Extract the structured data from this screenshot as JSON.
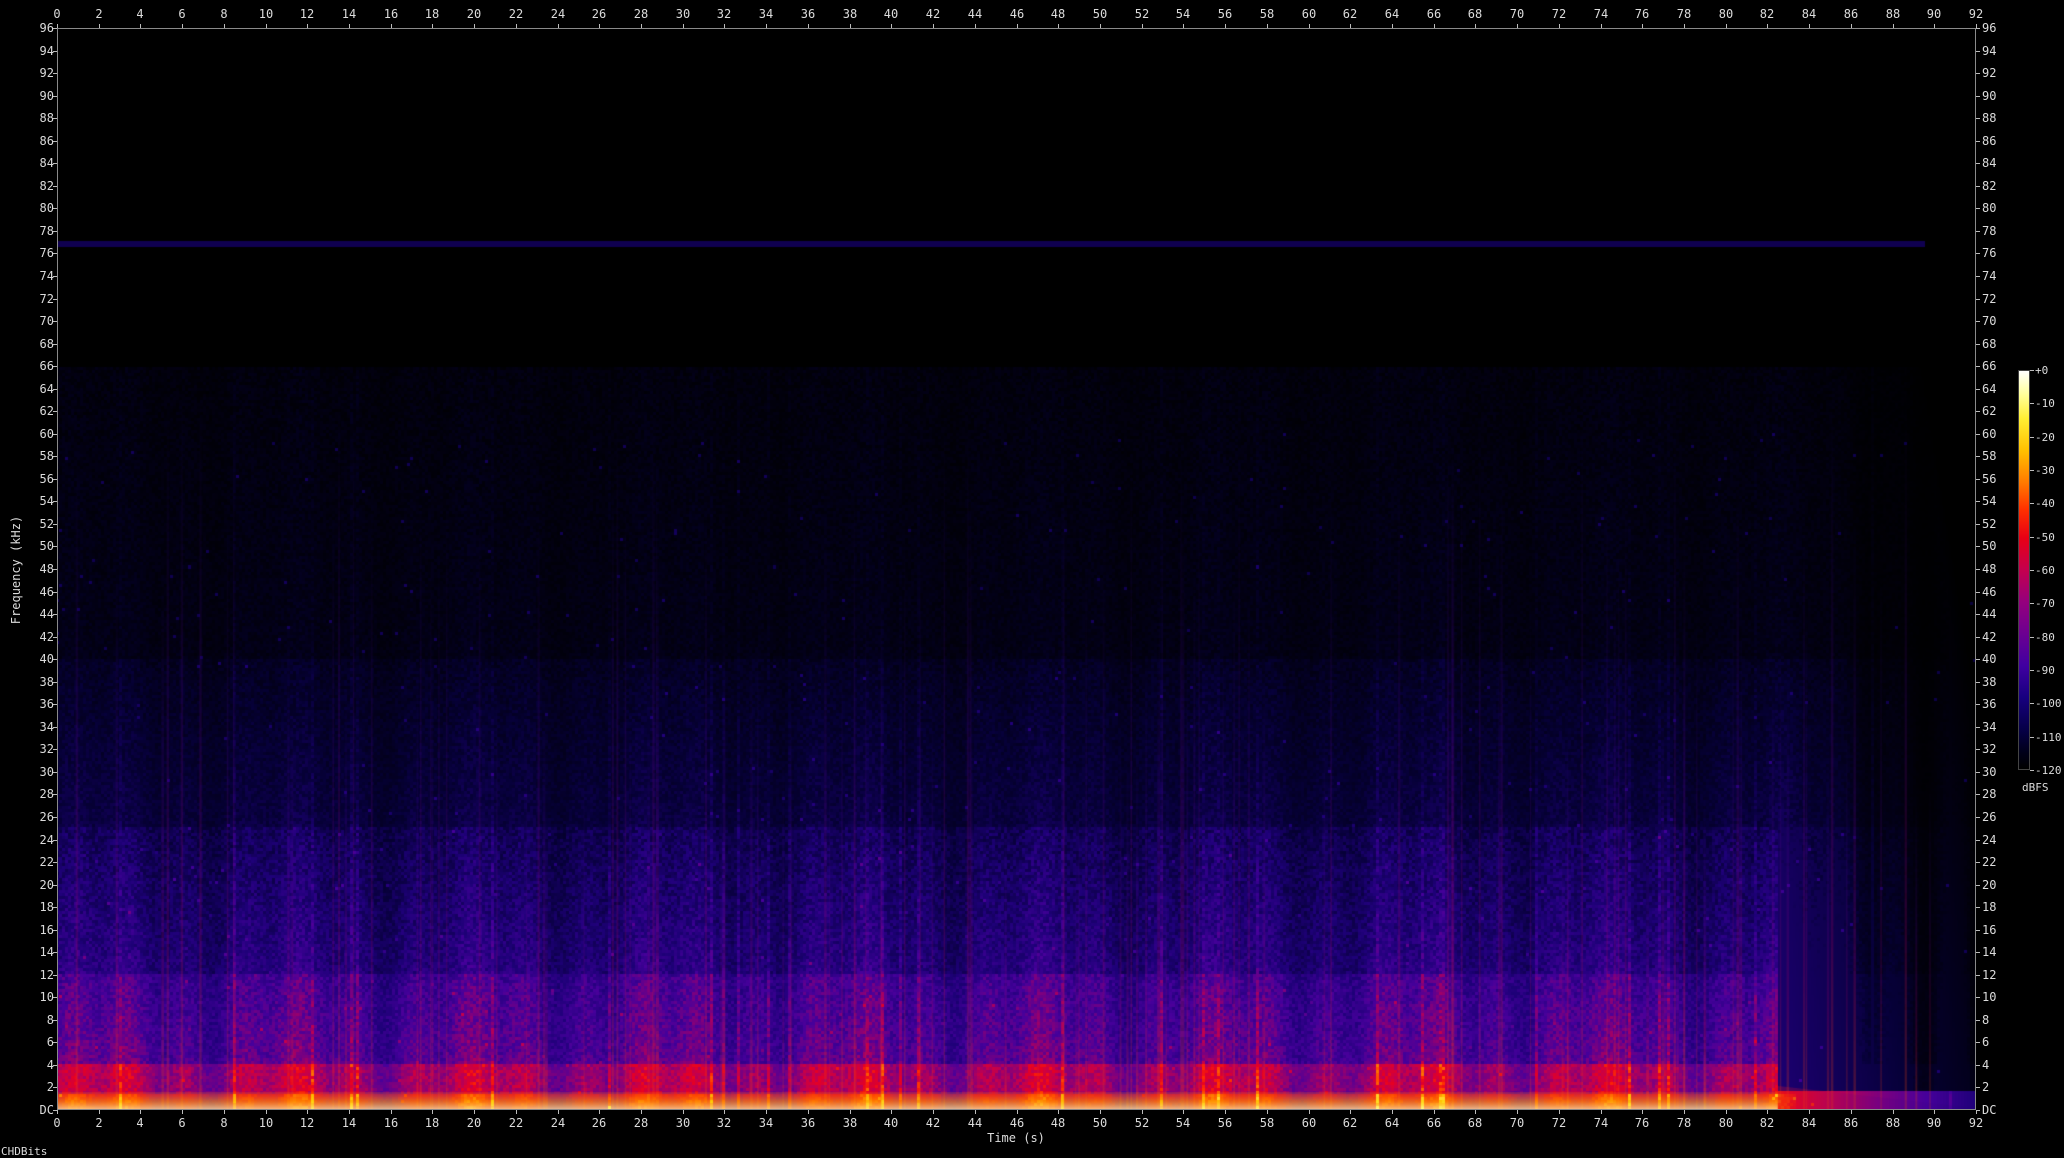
{
  "chart_data": {
    "type": "heatmap",
    "title": "",
    "xlabel": "Time (s)",
    "ylabel": "Frequency (kHz)",
    "x_range": [
      0,
      92
    ],
    "y_range": [
      0,
      96
    ],
    "x_ticks": [
      "0",
      "2",
      "4",
      "6",
      "8",
      "10",
      "12",
      "14",
      "16",
      "18",
      "20",
      "22",
      "24",
      "26",
      "28",
      "30",
      "32",
      "34",
      "36",
      "38",
      "40",
      "42",
      "44",
      "46",
      "48",
      "50",
      "52",
      "54",
      "56",
      "58",
      "60",
      "62",
      "64",
      "66",
      "68",
      "70",
      "72",
      "74",
      "76",
      "78",
      "80",
      "82",
      "84",
      "86",
      "88",
      "90",
      "92"
    ],
    "y_ticks": [
      "DC",
      "2",
      "4",
      "6",
      "8",
      "10",
      "12",
      "14",
      "16",
      "18",
      "20",
      "22",
      "24",
      "26",
      "28",
      "30",
      "32",
      "34",
      "36",
      "38",
      "40",
      "42",
      "44",
      "46",
      "48",
      "50",
      "52",
      "54",
      "56",
      "58",
      "60",
      "62",
      "64",
      "66",
      "68",
      "70",
      "72",
      "74",
      "76",
      "78",
      "80",
      "82",
      "84",
      "86",
      "88",
      "90",
      "92",
      "94",
      "96"
    ],
    "colorbar": {
      "unit": "dBFS",
      "ticks": [
        "+0",
        "-10",
        "-20",
        "-30",
        "-40",
        "-50",
        "-60",
        "-70",
        "-80",
        "-90",
        "-100",
        "-110",
        "-120"
      ],
      "range": [
        -120,
        0
      ]
    },
    "x_title_color": "#dcdcdc",
    "footer_text": "CHDBits",
    "notable_features": {
      "tone_line_frequency_khz": 76.8,
      "energy_band_upper_khz_typical": 25,
      "energy_band_upper_khz_peak": 66,
      "fade_out_start_s": 82.5,
      "fade_out_end_s": 92
    }
  }
}
